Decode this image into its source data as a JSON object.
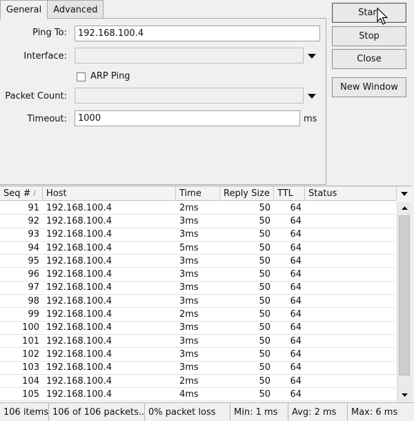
{
  "tabs": [
    {
      "label": "General",
      "active": true
    },
    {
      "label": "Advanced",
      "active": false
    }
  ],
  "form": {
    "ping_to": {
      "label": "Ping To:",
      "value": "192.168.100.4"
    },
    "interface": {
      "label": "Interface:",
      "value": ""
    },
    "arp_ping": {
      "label": "ARP Ping",
      "checked": false
    },
    "packet_count": {
      "label": "Packet Count:",
      "value": ""
    },
    "timeout": {
      "label": "Timeout:",
      "value": "1000",
      "unit": "ms"
    }
  },
  "buttons": {
    "start": "Start",
    "stop": "Stop",
    "close": "Close",
    "new_window": "New Window"
  },
  "table": {
    "columns": [
      "Seq #",
      "Host",
      "Time",
      "Reply Size",
      "TTL",
      "Status"
    ],
    "sort_indicator": "/",
    "rows": [
      {
        "seq": "91",
        "host": "192.168.100.4",
        "time": "2ms",
        "size": "50",
        "ttl": "64",
        "status": ""
      },
      {
        "seq": "92",
        "host": "192.168.100.4",
        "time": "3ms",
        "size": "50",
        "ttl": "64",
        "status": ""
      },
      {
        "seq": "93",
        "host": "192.168.100.4",
        "time": "3ms",
        "size": "50",
        "ttl": "64",
        "status": ""
      },
      {
        "seq": "94",
        "host": "192.168.100.4",
        "time": "5ms",
        "size": "50",
        "ttl": "64",
        "status": ""
      },
      {
        "seq": "95",
        "host": "192.168.100.4",
        "time": "3ms",
        "size": "50",
        "ttl": "64",
        "status": ""
      },
      {
        "seq": "96",
        "host": "192.168.100.4",
        "time": "3ms",
        "size": "50",
        "ttl": "64",
        "status": ""
      },
      {
        "seq": "97",
        "host": "192.168.100.4",
        "time": "3ms",
        "size": "50",
        "ttl": "64",
        "status": ""
      },
      {
        "seq": "98",
        "host": "192.168.100.4",
        "time": "3ms",
        "size": "50",
        "ttl": "64",
        "status": ""
      },
      {
        "seq": "99",
        "host": "192.168.100.4",
        "time": "2ms",
        "size": "50",
        "ttl": "64",
        "status": ""
      },
      {
        "seq": "100",
        "host": "192.168.100.4",
        "time": "3ms",
        "size": "50",
        "ttl": "64",
        "status": ""
      },
      {
        "seq": "101",
        "host": "192.168.100.4",
        "time": "3ms",
        "size": "50",
        "ttl": "64",
        "status": ""
      },
      {
        "seq": "102",
        "host": "192.168.100.4",
        "time": "3ms",
        "size": "50",
        "ttl": "64",
        "status": ""
      },
      {
        "seq": "103",
        "host": "192.168.100.4",
        "time": "3ms",
        "size": "50",
        "ttl": "64",
        "status": ""
      },
      {
        "seq": "104",
        "host": "192.168.100.4",
        "time": "2ms",
        "size": "50",
        "ttl": "64",
        "status": ""
      },
      {
        "seq": "105",
        "host": "192.168.100.4",
        "time": "4ms",
        "size": "50",
        "ttl": "64",
        "status": ""
      }
    ]
  },
  "status_bar": {
    "items": "106 items",
    "packets": "106 of 106 packets...",
    "loss": "0% packet loss",
    "min": "Min: 1 ms",
    "avg": "Avg: 2 ms",
    "max": "Max: 6 ms"
  },
  "icons": {
    "dropdown": "chevron-down-icon",
    "scroll_up": "scroll-up-icon",
    "scroll_down": "scroll-down-icon",
    "column_menu": "column-menu-icon",
    "cursor": "mouse-pointer-icon"
  }
}
